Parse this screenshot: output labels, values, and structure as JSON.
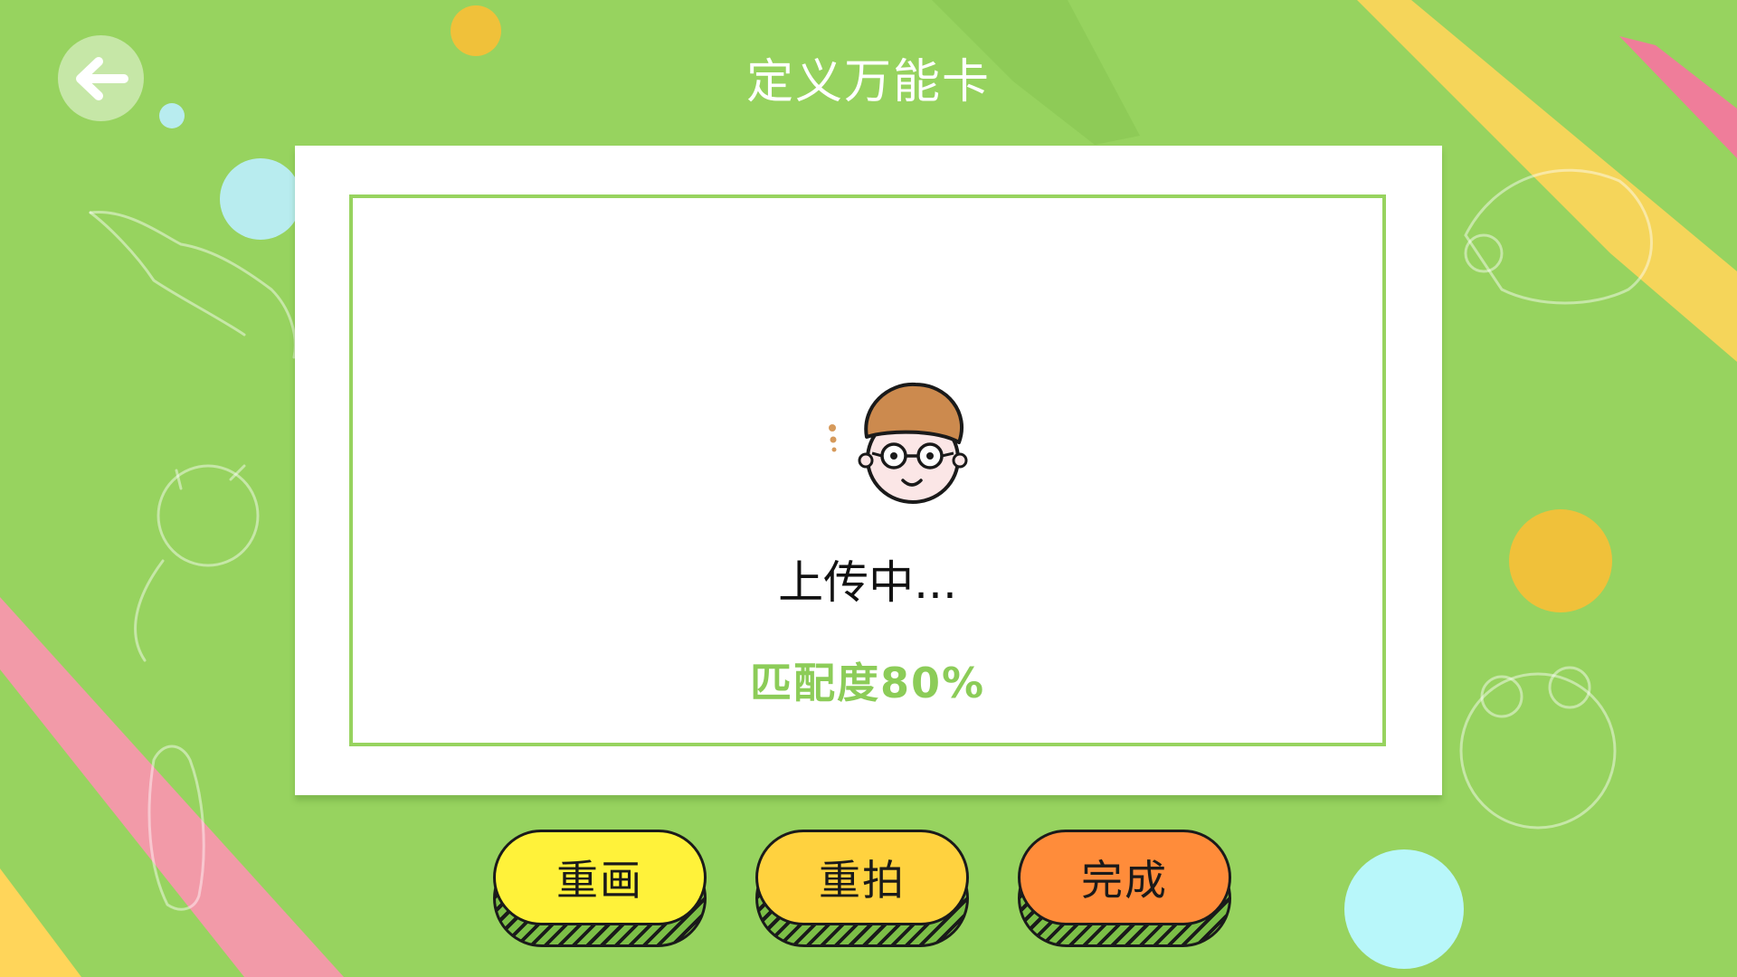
{
  "header": {
    "title": "定义万能卡",
    "back_icon": "arrow-left-icon"
  },
  "card": {
    "status_text": "上传中...",
    "match_text": "匹配度80%",
    "avatar_icon": "boy-with-glasses-avatar"
  },
  "actions": {
    "redraw_label": "重画",
    "retake_label": "重拍",
    "done_label": "完成"
  },
  "colors": {
    "background": "#97d35f",
    "accent_green": "#8ccc58",
    "redraw_button": "#fff23a",
    "retake_button": "#ffd23f",
    "done_button": "#ff8c3a"
  }
}
